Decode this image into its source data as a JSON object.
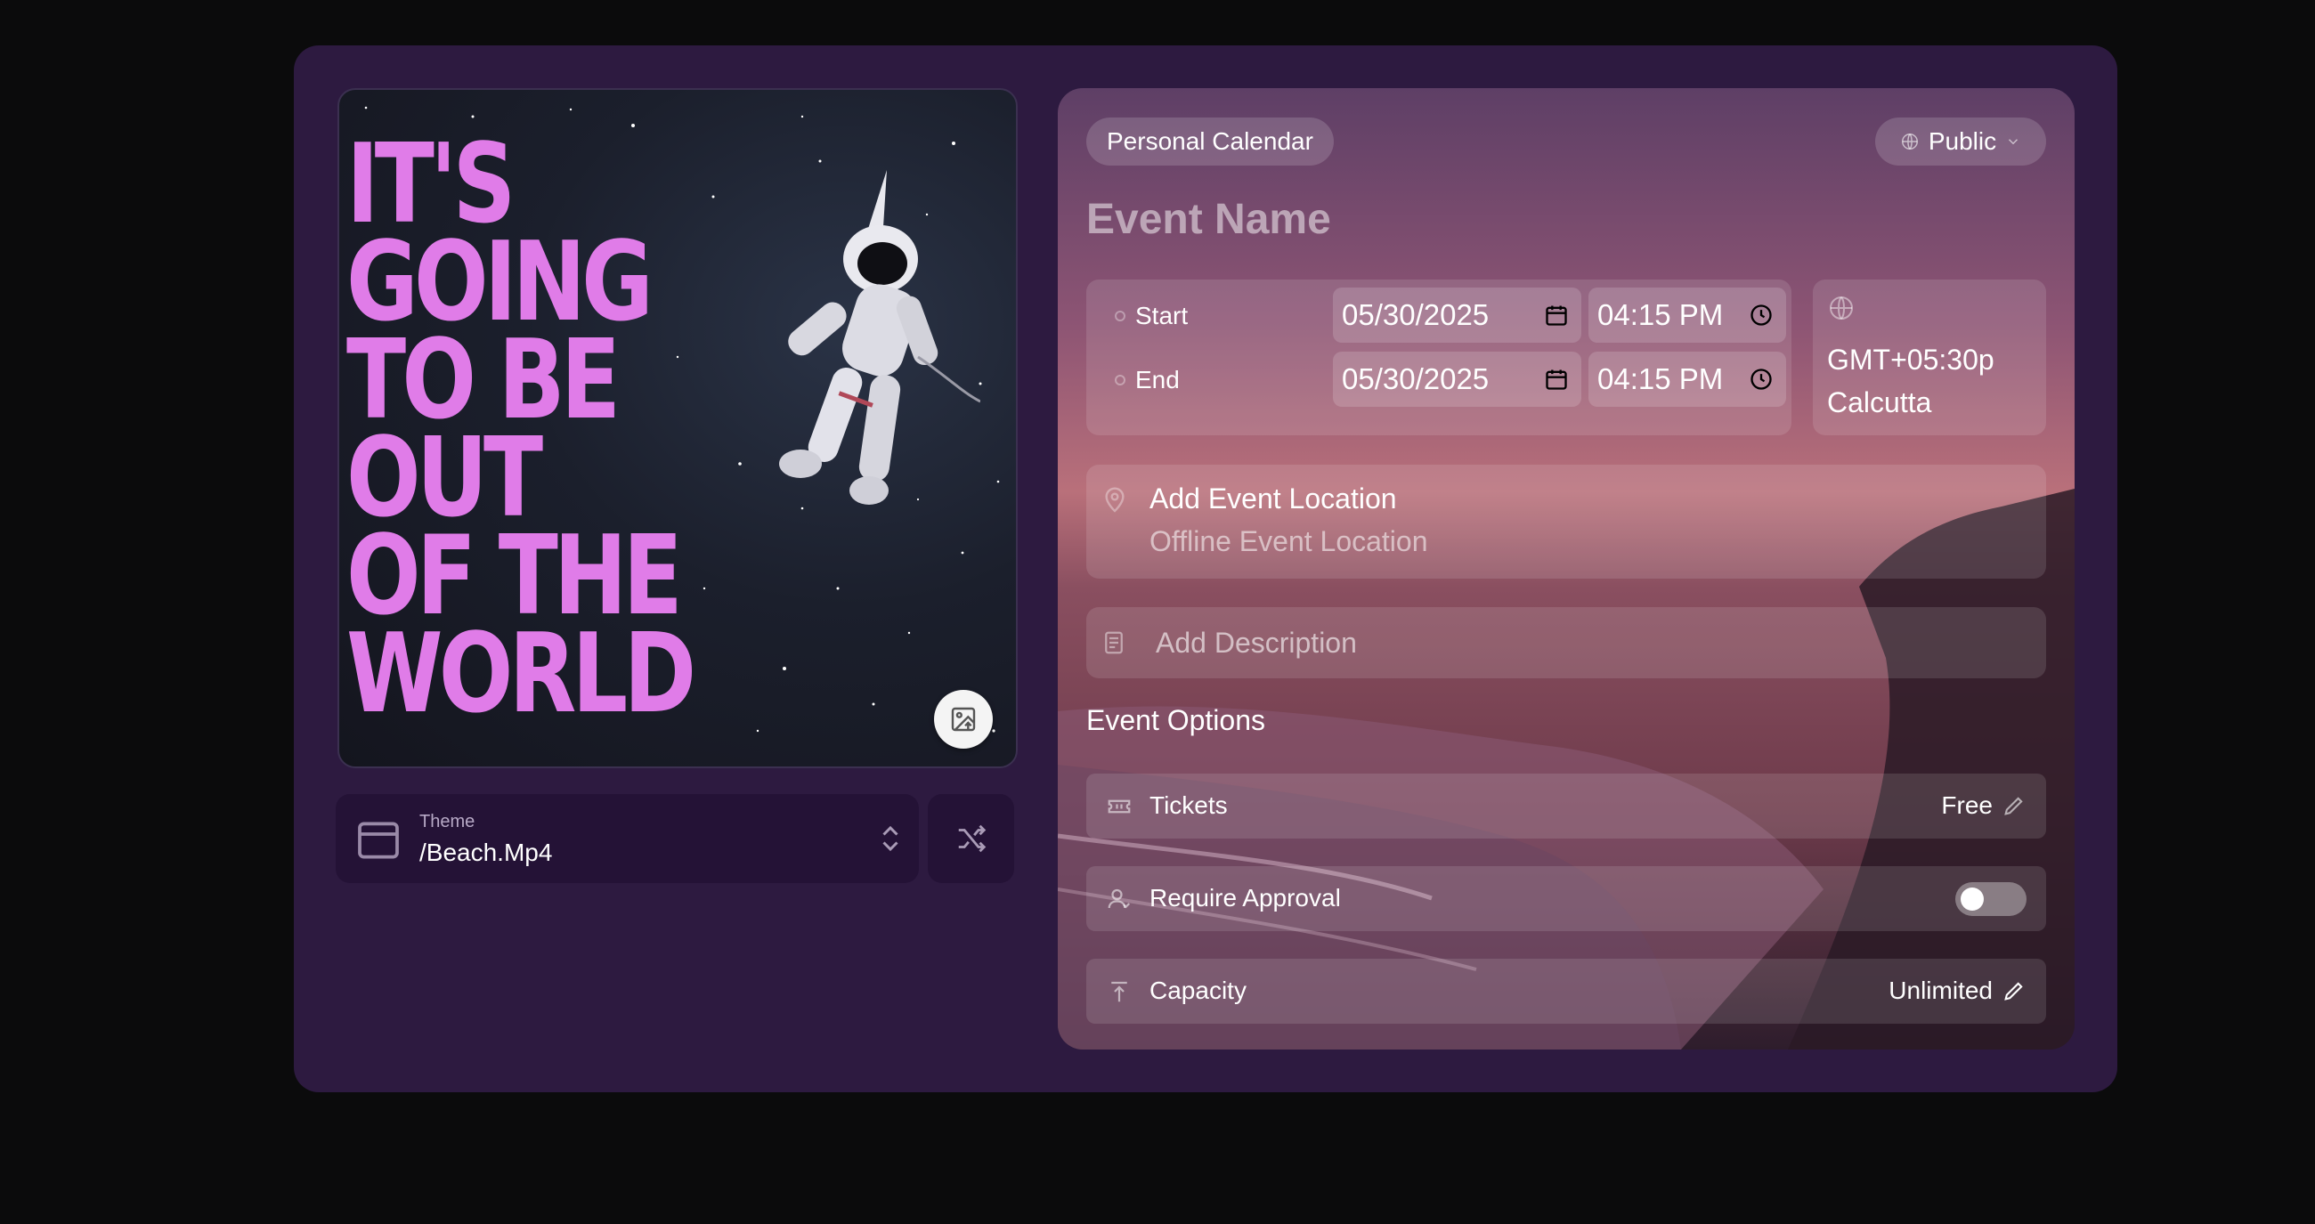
{
  "poster": {
    "title": "IT'S\nGOING\nTO BE\nOUT\nOF THE\nWORLD"
  },
  "theme": {
    "label": "Theme",
    "value": "/Beach.Mp4"
  },
  "header": {
    "calendar": "Personal Calendar",
    "visibility": "Public"
  },
  "event": {
    "name_placeholder": "Event Name"
  },
  "datetime": {
    "start_label": "Start",
    "start_date": "05/30/2025",
    "start_time": "04:15 PM",
    "end_label": "End",
    "end_date": "05/30/2025",
    "end_time": "04:15 PM",
    "timezone_line1": "GMT+05:30p",
    "timezone_line2": "Calcutta"
  },
  "location": {
    "title": "Add Event Location",
    "subtitle": "Offline Event Location"
  },
  "description": {
    "placeholder": "Add Description"
  },
  "options": {
    "title": "Event Options",
    "tickets_label": "Tickets",
    "tickets_value": "Free",
    "approval_label": "Require Approval",
    "approval_enabled": false,
    "capacity_label": "Capacity",
    "capacity_value": "Unlimited"
  },
  "colors": {
    "app_background": "#2d1a40",
    "page_background": "#0b0b0c",
    "poster_text": "#e07ce8",
    "theme_box": "#241236"
  },
  "icons": [
    "image-upload-icon",
    "frame-icon",
    "chevron-updown-icon",
    "shuffle-icon",
    "globe-icon",
    "chevron-down-icon",
    "calendar-icon",
    "clock-icon",
    "map-pin-icon",
    "document-icon",
    "ticket-icon",
    "user-check-icon",
    "arrow-up-to-line-icon",
    "pencil-icon"
  ]
}
